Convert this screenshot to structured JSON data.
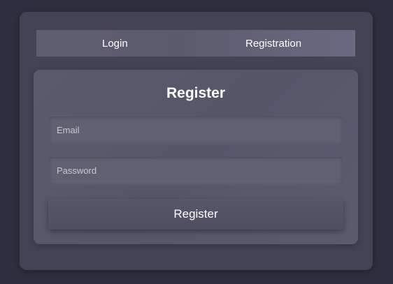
{
  "tabs": [
    {
      "label": "Login"
    },
    {
      "label": "Registration"
    }
  ],
  "form": {
    "title": "Register",
    "email_placeholder": "Email",
    "email_value": "",
    "password_placeholder": "Password",
    "password_value": "",
    "submit_label": "Register"
  }
}
